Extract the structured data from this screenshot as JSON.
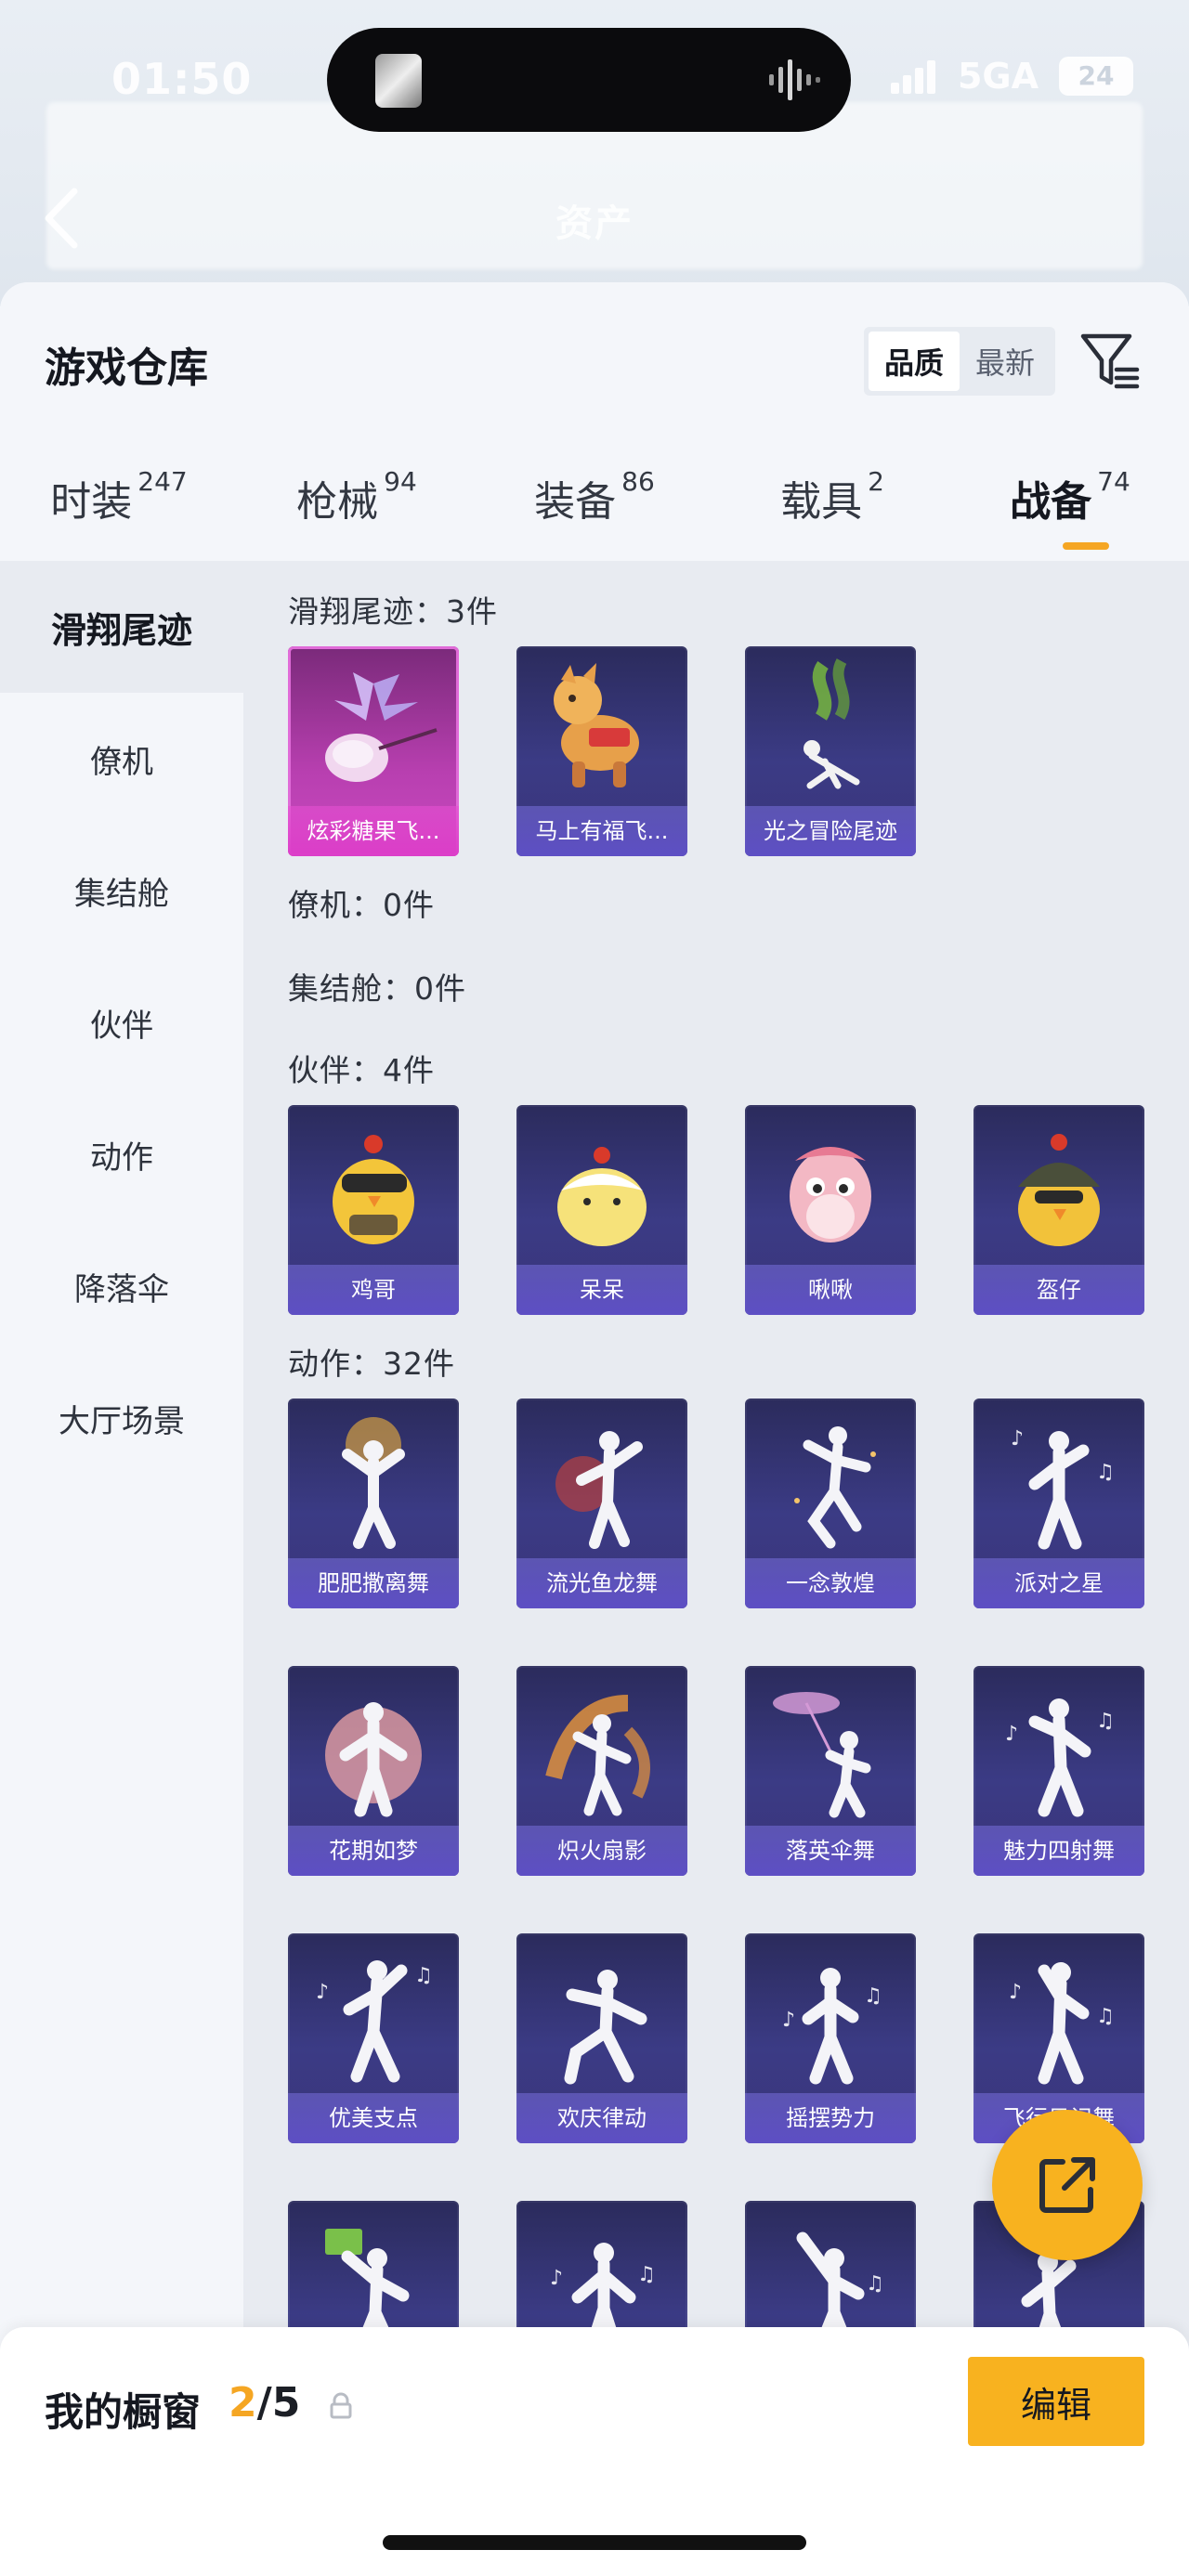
{
  "status": {
    "time": "01:50",
    "network": "5GA",
    "battery": "24"
  },
  "backdrop": {
    "title": "资产"
  },
  "header": {
    "title": "游戏仓库",
    "sort_options": [
      "品质",
      "最新"
    ],
    "sort_active": "品质"
  },
  "tabs": [
    {
      "label": "时装",
      "count": "247"
    },
    {
      "label": "枪械",
      "count": "94"
    },
    {
      "label": "装备",
      "count": "86"
    },
    {
      "label": "载具",
      "count": "2"
    },
    {
      "label": "战备",
      "count": "74"
    }
  ],
  "active_tab": "战备",
  "categories": [
    "滑翔尾迹",
    "僚机",
    "集结舱",
    "伙伴",
    "动作",
    "降落伞",
    "大厅场景"
  ],
  "active_category": "滑翔尾迹",
  "sections": {
    "glide_trail": {
      "title": "滑翔尾迹：3件",
      "items": [
        "炫彩糖果飞...",
        "马上有福飞...",
        "光之冒险尾迹"
      ]
    },
    "wingman": {
      "title": "僚机：0件"
    },
    "pod": {
      "title": "集结舱：0件"
    },
    "partner": {
      "title": "伙伴：4件",
      "items": [
        "鸡哥",
        "呆呆",
        "啾啾",
        "盔仔"
      ]
    },
    "emote": {
      "title": "动作：32件",
      "items": [
        "肥肥撒离舞",
        "流光鱼龙舞",
        "一念敦煌",
        "派对之星",
        "花期如梦",
        "炽火扇影",
        "落英伞舞",
        "魅力四射舞",
        "优美支点",
        "欢庆律动",
        "摇摆势力",
        "飞行日记舞"
      ]
    }
  },
  "showcase": {
    "title": "我的橱窗",
    "current": "2",
    "total": "/5",
    "edit_label": "编辑"
  },
  "colors": {
    "accent": "#f5a623",
    "card_purple": "#3b3b85",
    "card_pink": "#c94ac0"
  }
}
